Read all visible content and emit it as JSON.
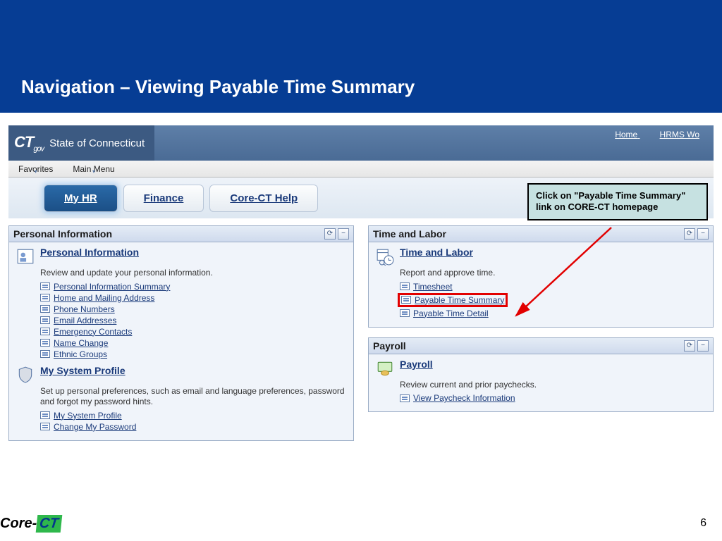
{
  "slide": {
    "title": "Navigation – Viewing Payable Time Summary",
    "page_number": "6"
  },
  "topbar": {
    "logo_main": "CT",
    "logo_sub": "gov",
    "org": "State of Connecticut",
    "links": {
      "home": "Home",
      "hrms": "HRMS Wo"
    }
  },
  "menubar": {
    "favorites": "Favorites",
    "main_menu": "Main Menu"
  },
  "tabs": {
    "myhr": "My HR",
    "finance": "Finance",
    "help": "Core-CT Help"
  },
  "callout": {
    "text": "Click on \"Payable Time Summary\" link on CORE-CT homepage"
  },
  "portlets": {
    "personal": {
      "title": "Personal Information",
      "section1": {
        "link": "Personal Information",
        "desc": "Review and update your personal information.",
        "items": [
          "Personal Information Summary",
          "Home and Mailing Address",
          "Phone Numbers",
          "Email Addresses",
          "Emergency Contacts",
          "Name Change",
          "Ethnic Groups"
        ]
      },
      "section2": {
        "link": "My System Profile",
        "desc": "Set up personal preferences, such as email and language preferences, password and forgot my password hints.",
        "items": [
          "My System Profile",
          "Change My Password"
        ]
      }
    },
    "timelabor": {
      "title": "Time and Labor",
      "section": {
        "link": "Time and Labor",
        "desc": "Report and approve time.",
        "items": [
          "Timesheet",
          "Payable Time Summary",
          "Payable Time Detail"
        ]
      }
    },
    "payroll": {
      "title": "Payroll",
      "section": {
        "link": "Payroll",
        "desc": "Review current and prior paychecks.",
        "items": [
          "View Paycheck Information"
        ]
      }
    }
  },
  "footer": {
    "core": "Core-",
    "ct": "CT"
  }
}
